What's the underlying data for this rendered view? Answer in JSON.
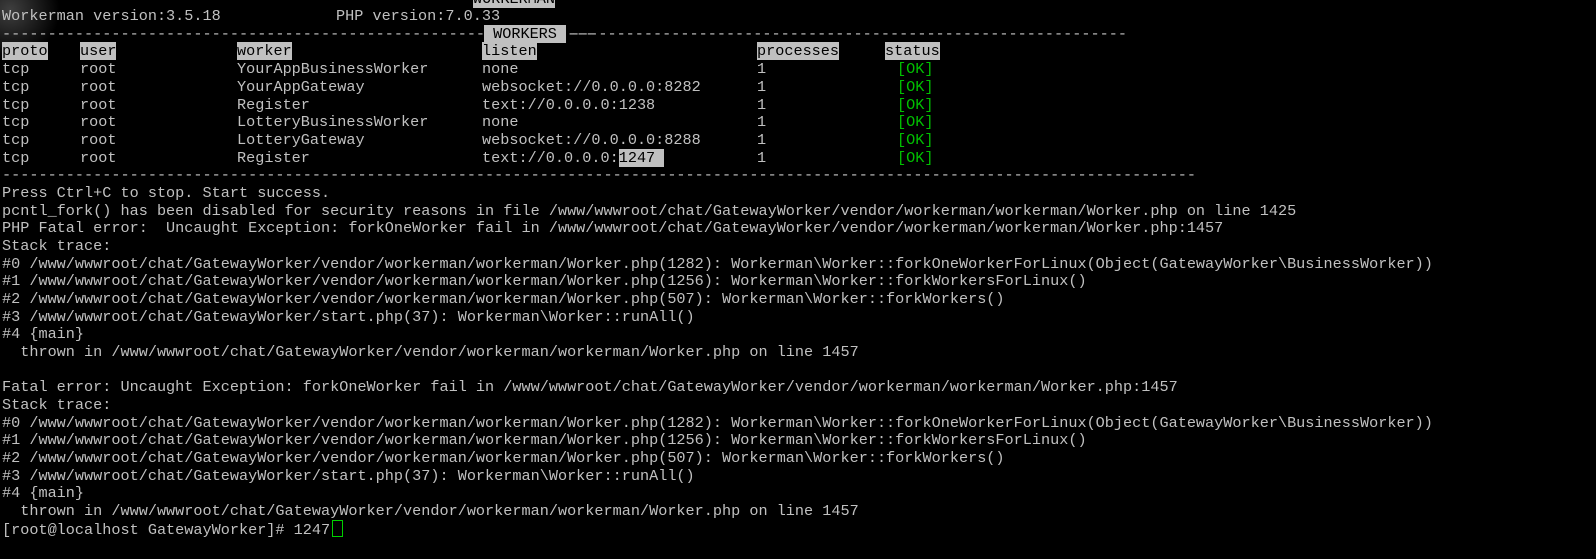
{
  "banner": {
    "title_top": "WORKERMAN",
    "workerman_version": "Workerman version:3.5.18",
    "php_version": "PHP version:7.0.33",
    "workers_rule": "-----------------------------------------------------------------",
    "workers_title": " WORKERS ",
    "workers_rule_right": "-------------------------------------------------------------",
    "columns": [
      "proto",
      "user",
      "worker",
      "listen",
      "processes",
      "status"
    ],
    "rows": [
      {
        "proto": "tcp",
        "user": "root",
        "worker": "YourAppBusinessWorker",
        "listen": "none",
        "processes": "1",
        "status": "[OK]"
      },
      {
        "proto": "tcp",
        "user": "root",
        "worker": "YourAppGateway",
        "listen": "websocket://0.0.0.0:8282",
        "processes": "1",
        "status": "[OK]"
      },
      {
        "proto": "tcp",
        "user": "root",
        "worker": "Register",
        "listen": "text://0.0.0.0:1238",
        "processes": "1",
        "status": "[OK]"
      },
      {
        "proto": "tcp",
        "user": "root",
        "worker": "LotteryBusinessWorker",
        "listen": "none",
        "processes": "1",
        "status": "[OK]"
      },
      {
        "proto": "tcp",
        "user": "root",
        "worker": "LotteryGateway",
        "listen": "websocket://0.0.0.0:8288",
        "processes": "1",
        "status": "[OK]"
      },
      {
        "proto": "tcp",
        "user": "root",
        "worker": "Register",
        "listen_prefix": "text://0.0.0.0:",
        "listen_selected": "1247 ",
        "processes": "1",
        "status": "[OK]"
      }
    ],
    "bottom_rule": "-----------------------------------------------------------------------------------------------------------------------------------"
  },
  "output": [
    "Press Ctrl+C to stop. Start success.",
    "pcntl_fork() has been disabled for security reasons in file /www/wwwroot/chat/GatewayWorker/vendor/workerman/workerman/Worker.php on line 1425",
    "PHP Fatal error:  Uncaught Exception: forkOneWorker fail in /www/wwwroot/chat/GatewayWorker/vendor/workerman/workerman/Worker.php:1457",
    "Stack trace:",
    "#0 /www/wwwroot/chat/GatewayWorker/vendor/workerman/workerman/Worker.php(1282): Workerman\\Worker::forkOneWorkerForLinux(Object(GatewayWorker\\BusinessWorker))",
    "#1 /www/wwwroot/chat/GatewayWorker/vendor/workerman/workerman/Worker.php(1256): Workerman\\Worker::forkWorkersForLinux()",
    "#2 /www/wwwroot/chat/GatewayWorker/vendor/workerman/workerman/Worker.php(507): Workerman\\Worker::forkWorkers()",
    "#3 /www/wwwroot/chat/GatewayWorker/start.php(37): Workerman\\Worker::runAll()",
    "#4 {main}",
    "  thrown in /www/wwwroot/chat/GatewayWorker/vendor/workerman/workerman/Worker.php on line 1457",
    "",
    "Fatal error: Uncaught Exception: forkOneWorker fail in /www/wwwroot/chat/GatewayWorker/vendor/workerman/workerman/Worker.php:1457",
    "Stack trace:",
    "#0 /www/wwwroot/chat/GatewayWorker/vendor/workerman/workerman/Worker.php(1282): Workerman\\Worker::forkOneWorkerForLinux(Object(GatewayWorker\\BusinessWorker))",
    "#1 /www/wwwroot/chat/GatewayWorker/vendor/workerman/workerman/Worker.php(1256): Workerman\\Worker::forkWorkersForLinux()",
    "#2 /www/wwwroot/chat/GatewayWorker/vendor/workerman/workerman/Worker.php(507): Workerman\\Worker::forkWorkers()",
    "#3 /www/wwwroot/chat/GatewayWorker/start.php(37): Workerman\\Worker::runAll()",
    "#4 {main}",
    "  thrown in /www/wwwroot/chat/GatewayWorker/vendor/workerman/workerman/Worker.php on line 1457"
  ],
  "prompt": {
    "text": "[root@localhost GatewayWorker]# ",
    "input": "1247"
  },
  "colors": {
    "background": "#000000",
    "text": "#c0c0c0",
    "highlight": "#c0c0c0",
    "ok": "#00c000",
    "cursor": "#00d000"
  }
}
